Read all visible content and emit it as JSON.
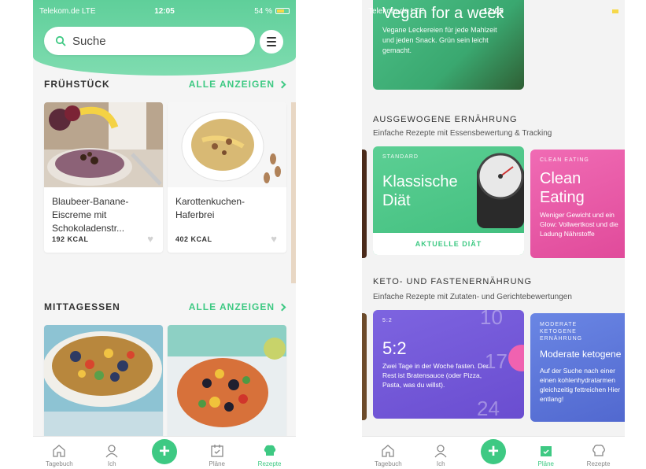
{
  "left": {
    "status": {
      "carrier": "Telekom.de  LTE",
      "time": "12:05",
      "battery": "54 %"
    },
    "search": {
      "placeholder": "Suche"
    },
    "sections": [
      {
        "title": "FRÜHSTÜCK",
        "link": "ALLE ANZEIGEN",
        "cards": [
          {
            "title": "Blaubeer-Banane-Eiscreme mit Schokoladenstr...",
            "kcal": "192 KCAL"
          },
          {
            "title": "Karottenkuchen-Haferbrei",
            "kcal": "402 KCAL"
          }
        ]
      },
      {
        "title": "MITTAGESSEN",
        "link": "ALLE ANZEIGEN"
      }
    ],
    "tabs": [
      "Tagebuch",
      "Ich",
      "Pläne",
      "Rezepte"
    ]
  },
  "right": {
    "status": {
      "carrier": "Telekom.de LTE",
      "time": "12:05"
    },
    "vegan": {
      "title": "Vegan for a week",
      "desc": "Vegane Leckereien für jede Mahlzeit und jeden Snack. Grün sein leicht gemacht."
    },
    "balanced": {
      "title": "AUSGEWOGENE ERNÄHRUNG",
      "subtitle": "Einfache Rezepte mit Essensbewertung & Tracking",
      "cards": [
        {
          "tag": "STANDARD",
          "title": "Klassische Diät",
          "button": "AKTUELLE DIÄT"
        },
        {
          "tag": "CLEAN EATING",
          "title": "Clean Eating",
          "desc": "Weniger Gewicht und ein Glow: Vollwertkost und die Ladung Nährstoffe"
        }
      ]
    },
    "keto": {
      "title": "KETO- UND FASTENERNÄHRUNG",
      "subtitle": "Einfache Rezepte mit Zutaten- und Gerichtebewertungen",
      "cards": [
        {
          "tag": "5:2",
          "title": "5:2",
          "desc": "Zwei Tage in der Woche fasten. Der Rest ist Bratensauce (oder Pizza, Pasta, was du willst).",
          "clock": [
            "10",
            "17",
            "24"
          ]
        },
        {
          "tag": "MODERATE KETOGENE ERNÄHRUNG",
          "title": "Moderate ketogene",
          "desc": "Auf der Suche nach einer einen kohlenhydratarmen gleichzeitig fettreichen Hier entlang!"
        }
      ]
    },
    "tabs": [
      "Tagebuch",
      "Ich",
      "Pläne",
      "Rezepte"
    ]
  },
  "colors": {
    "accent": "#3ec983",
    "header": "#6fd6a5",
    "clean": "#e85aa8",
    "keto": "#7a5ad8",
    "moderate": "#5b76d8"
  },
  "icons": [
    "search-icon",
    "menu-icon",
    "heart-icon",
    "chevron-right-icon",
    "home-icon",
    "person-icon",
    "plus-icon",
    "calendar-icon",
    "chef-hat-icon"
  ]
}
